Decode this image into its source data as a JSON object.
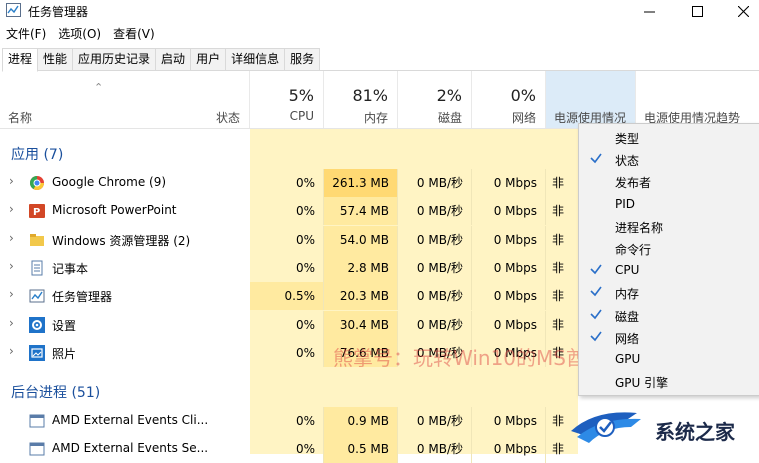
{
  "window": {
    "title": "任务管理器"
  },
  "menu": [
    "文件(F)",
    "选项(O)",
    "查看(V)"
  ],
  "tabs": [
    "进程",
    "性能",
    "应用历史记录",
    "启动",
    "用户",
    "详细信息",
    "服务"
  ],
  "columns": {
    "name": "名称",
    "status": "状态",
    "cpu": {
      "pct": "5%",
      "label": "CPU"
    },
    "memory": {
      "pct": "81%",
      "label": "内存"
    },
    "disk": {
      "pct": "2%",
      "label": "磁盘"
    },
    "network": {
      "pct": "0%",
      "label": "网络"
    },
    "power": "电源使用情况",
    "power_trend": "电源使用情况趋势"
  },
  "groups": {
    "apps": "应用 (7)",
    "background": "后台进程 (51)"
  },
  "rows": [
    {
      "name": "Google Chrome (9)",
      "icon": "chrome-icon",
      "cpu": "0%",
      "mem": "261.3 MB",
      "disk": "0 MB/秒",
      "net": "0 Mbps",
      "power": "非常"
    },
    {
      "name": "Microsoft PowerPoint",
      "icon": "powerpoint-icon",
      "cpu": "0%",
      "mem": "57.4 MB",
      "disk": "0 MB/秒",
      "net": "0 Mbps",
      "power": "非常"
    },
    {
      "name": "Windows 资源管理器 (2)",
      "icon": "explorer-icon",
      "cpu": "0%",
      "mem": "54.0 MB",
      "disk": "0 MB/秒",
      "net": "0 Mbps",
      "power": "非常"
    },
    {
      "name": "记事本",
      "icon": "notepad-icon",
      "cpu": "0%",
      "mem": "2.8 MB",
      "disk": "0 MB/秒",
      "net": "0 Mbps",
      "power": "非常"
    },
    {
      "name": "任务管理器",
      "icon": "task-manager-icon",
      "cpu": "0.5%",
      "mem": "20.3 MB",
      "disk": "0 MB/秒",
      "net": "0 Mbps",
      "power": "非常"
    },
    {
      "name": "设置",
      "icon": "settings-icon",
      "cpu": "0%",
      "mem": "30.4 MB",
      "disk": "0 MB/秒",
      "net": "0 Mbps",
      "power": "非常"
    },
    {
      "name": "照片",
      "icon": "photos-icon",
      "cpu": "0%",
      "mem": "76.6 MB",
      "disk": "0 MB/秒",
      "net": "0 Mbps",
      "power": "非常"
    }
  ],
  "bg_rows": [
    {
      "name": "AMD External Events Cli...",
      "cpu": "0%",
      "mem": "0.9 MB",
      "disk": "0 MB/秒",
      "net": "0 Mbps",
      "power": "非常"
    },
    {
      "name": "AMD External Events Se...",
      "cpu": "0%",
      "mem": "0.5 MB",
      "disk": "0 MB/秒",
      "net": "0 Mbps",
      "power": "非常"
    }
  ],
  "context_menu": [
    {
      "label": "类型",
      "checked": false
    },
    {
      "label": "状态",
      "checked": true
    },
    {
      "label": "发布者",
      "checked": false
    },
    {
      "label": "PID",
      "checked": false
    },
    {
      "label": "进程名称",
      "checked": false
    },
    {
      "label": "命令行",
      "checked": false
    },
    {
      "label": "CPU",
      "checked": true
    },
    {
      "label": "内存",
      "checked": true
    },
    {
      "label": "磁盘",
      "checked": true
    },
    {
      "label": "网络",
      "checked": true
    },
    {
      "label": "GPU",
      "checked": false
    },
    {
      "label": "GPU 引擎",
      "checked": false
    }
  ],
  "watermark": "熊掌号：玩转Win10的MS酋长",
  "brand": "系统之家",
  "colors": {
    "heat_light": "#fff4c4",
    "heat_mid": "#ffeaa0",
    "heat_strong": "#ffd973",
    "check": "#2a6fc9",
    "group": "#1a4f9c"
  }
}
